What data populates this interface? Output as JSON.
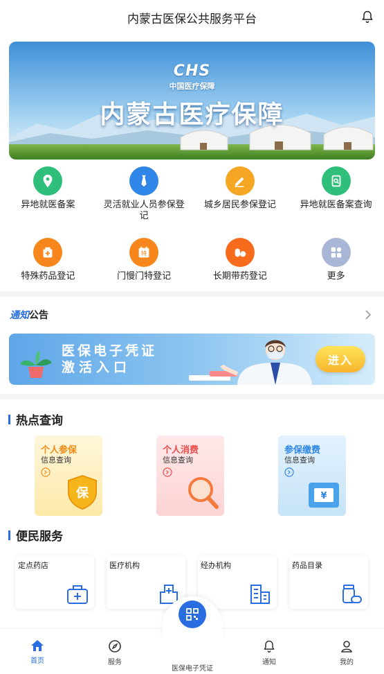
{
  "header": {
    "title": "内蒙古医保公共服务平台"
  },
  "banner": {
    "logo": "CHS",
    "logo_sub": "中国医疗保障",
    "title": "内蒙古医疗保障"
  },
  "grid_row1": [
    {
      "label": "异地就医备案",
      "icon": "location-icon",
      "color": "#2fbf7a"
    },
    {
      "label": "灵活就业人员参保登记",
      "icon": "tie-icon",
      "color": "#2f86e6"
    },
    {
      "label": "城乡居民参保登记",
      "icon": "pencil-icon",
      "color": "#f5a623"
    },
    {
      "label": "异地就医备案查询",
      "icon": "clipboard-search-icon",
      "color": "#2fbf7a"
    }
  ],
  "grid_row2": [
    {
      "label": "特殊药品登记",
      "icon": "medicine-box-icon",
      "color": "#f7861c"
    },
    {
      "label": "门慢门特登记",
      "icon": "calendar-special-icon",
      "color": "#f7861c"
    },
    {
      "label": "长期带药登记",
      "icon": "pill-icon",
      "color": "#f76b1c"
    },
    {
      "label": "更多",
      "icon": "more-grid-icon",
      "color": "#a9b7d6"
    }
  ],
  "notice": {
    "label_a": "通知",
    "label_b": "公告"
  },
  "promo": {
    "line1": "医保电子凭证",
    "line2": "激活入口",
    "button": "进入"
  },
  "hot": {
    "title": "热点查询",
    "cards": [
      {
        "title": "个人参保",
        "sub": "信息查询",
        "title_color": "#f08a12",
        "badge": "保"
      },
      {
        "title": "个人消费",
        "sub": "信息查询",
        "title_color": "#ef4b4b"
      },
      {
        "title": "参保缴费",
        "sub": "信息查询",
        "title_color": "#2f86e6",
        "badge": "¥"
      }
    ]
  },
  "services": {
    "title": "便民服务",
    "items": [
      {
        "label": "定点药店",
        "icon": "medkit-icon"
      },
      {
        "label": "医疗机构",
        "icon": "hospital-icon"
      },
      {
        "label": "经办机构",
        "icon": "building-icon"
      },
      {
        "label": "药品目录",
        "icon": "pill-bottle-icon"
      }
    ]
  },
  "tabbar": {
    "home": "首页",
    "service": "服务",
    "ecard": "医保电子凭证",
    "notify": "通知",
    "mine": "我的"
  },
  "colors": {
    "accent": "#2a6de0"
  }
}
